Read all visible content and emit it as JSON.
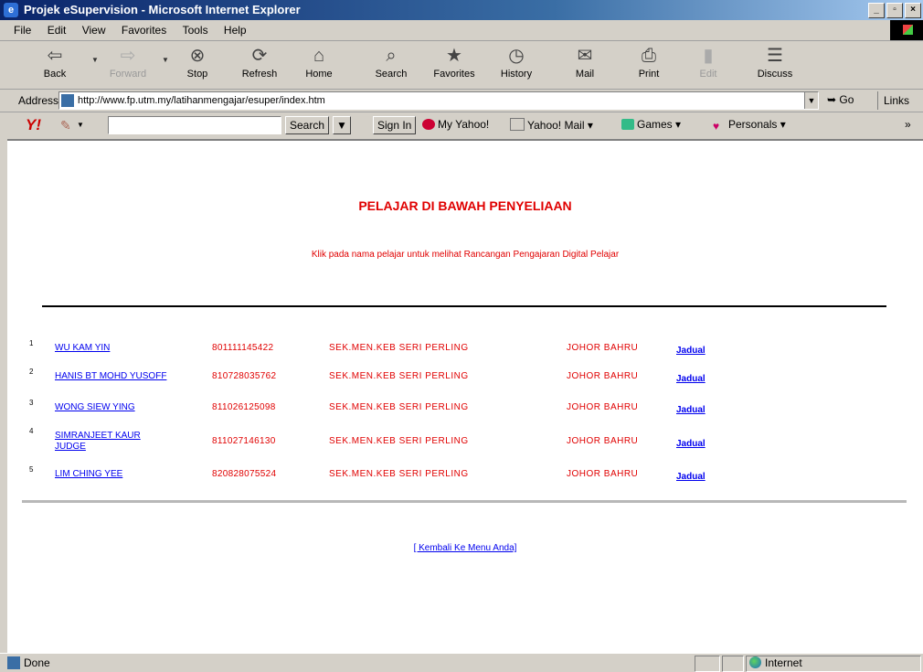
{
  "window": {
    "title": "Projek eSupervision - Microsoft Internet Explorer"
  },
  "menu": [
    "File",
    "Edit",
    "View",
    "Favorites",
    "Tools",
    "Help"
  ],
  "toolbar": {
    "back": "Back",
    "forward": "Forward",
    "stop": "Stop",
    "refresh": "Refresh",
    "home": "Home",
    "search": "Search",
    "favorites": "Favorites",
    "history": "History",
    "mail": "Mail",
    "print": "Print",
    "edit": "Edit",
    "discuss": "Discuss"
  },
  "address": {
    "label": "Address",
    "url": "http://www.fp.utm.my/latihanmengajar/esuper/index.htm",
    "go": "Go",
    "links": "Links"
  },
  "yahoo_bar": {
    "search_button": "Search",
    "sign_in": "Sign In",
    "my_yahoo": "My Yahoo!",
    "yahoo_mail": "Yahoo! Mail",
    "games": "Games",
    "personals": "Personals"
  },
  "page": {
    "heading": "PELAJAR DI BAWAH PENYELIAAN",
    "instruction": "Klik pada nama pelajar untuk melihat Rancangan Pengajaran Digital Pelajar",
    "rows": [
      {
        "num": "1",
        "name": "WU KAM YIN",
        "ic": "801111145422",
        "school": "SEK.MEN.KEB SERI PERLING",
        "city": "JOHOR BAHRU",
        "link": "Jadual"
      },
      {
        "num": "2",
        "name": "HANIS BT MOHD YUSOFF",
        "ic": "810728035762",
        "school": "SEK.MEN.KEB SERI PERLING",
        "city": "JOHOR BAHRU",
        "link": "Jadual"
      },
      {
        "num": "3",
        "name": "WONG SIEW YING",
        "ic": "811026125098",
        "school": "SEK.MEN.KEB SERI PERLING",
        "city": "JOHOR BAHRU",
        "link": "Jadual"
      },
      {
        "num": "4",
        "name": "SIMRANJEET KAUR JUDGE",
        "ic": "811027146130",
        "school": "SEK.MEN.KEB SERI PERLING",
        "city": "JOHOR BAHRU",
        "link": "Jadual"
      },
      {
        "num": "5",
        "name": "LIM CHING YEE",
        "ic": "820828075524",
        "school": "SEK.MEN.KEB SERI PERLING",
        "city": "JOHOR BAHRU",
        "link": "Jadual"
      }
    ],
    "back_link": "[ Kembali Ke Menu Anda]"
  },
  "status": {
    "text": "Done",
    "zone": "Internet"
  },
  "colors": {
    "heading": "#e00000",
    "link": "#0000ee",
    "titlebar": "#0a246a"
  }
}
